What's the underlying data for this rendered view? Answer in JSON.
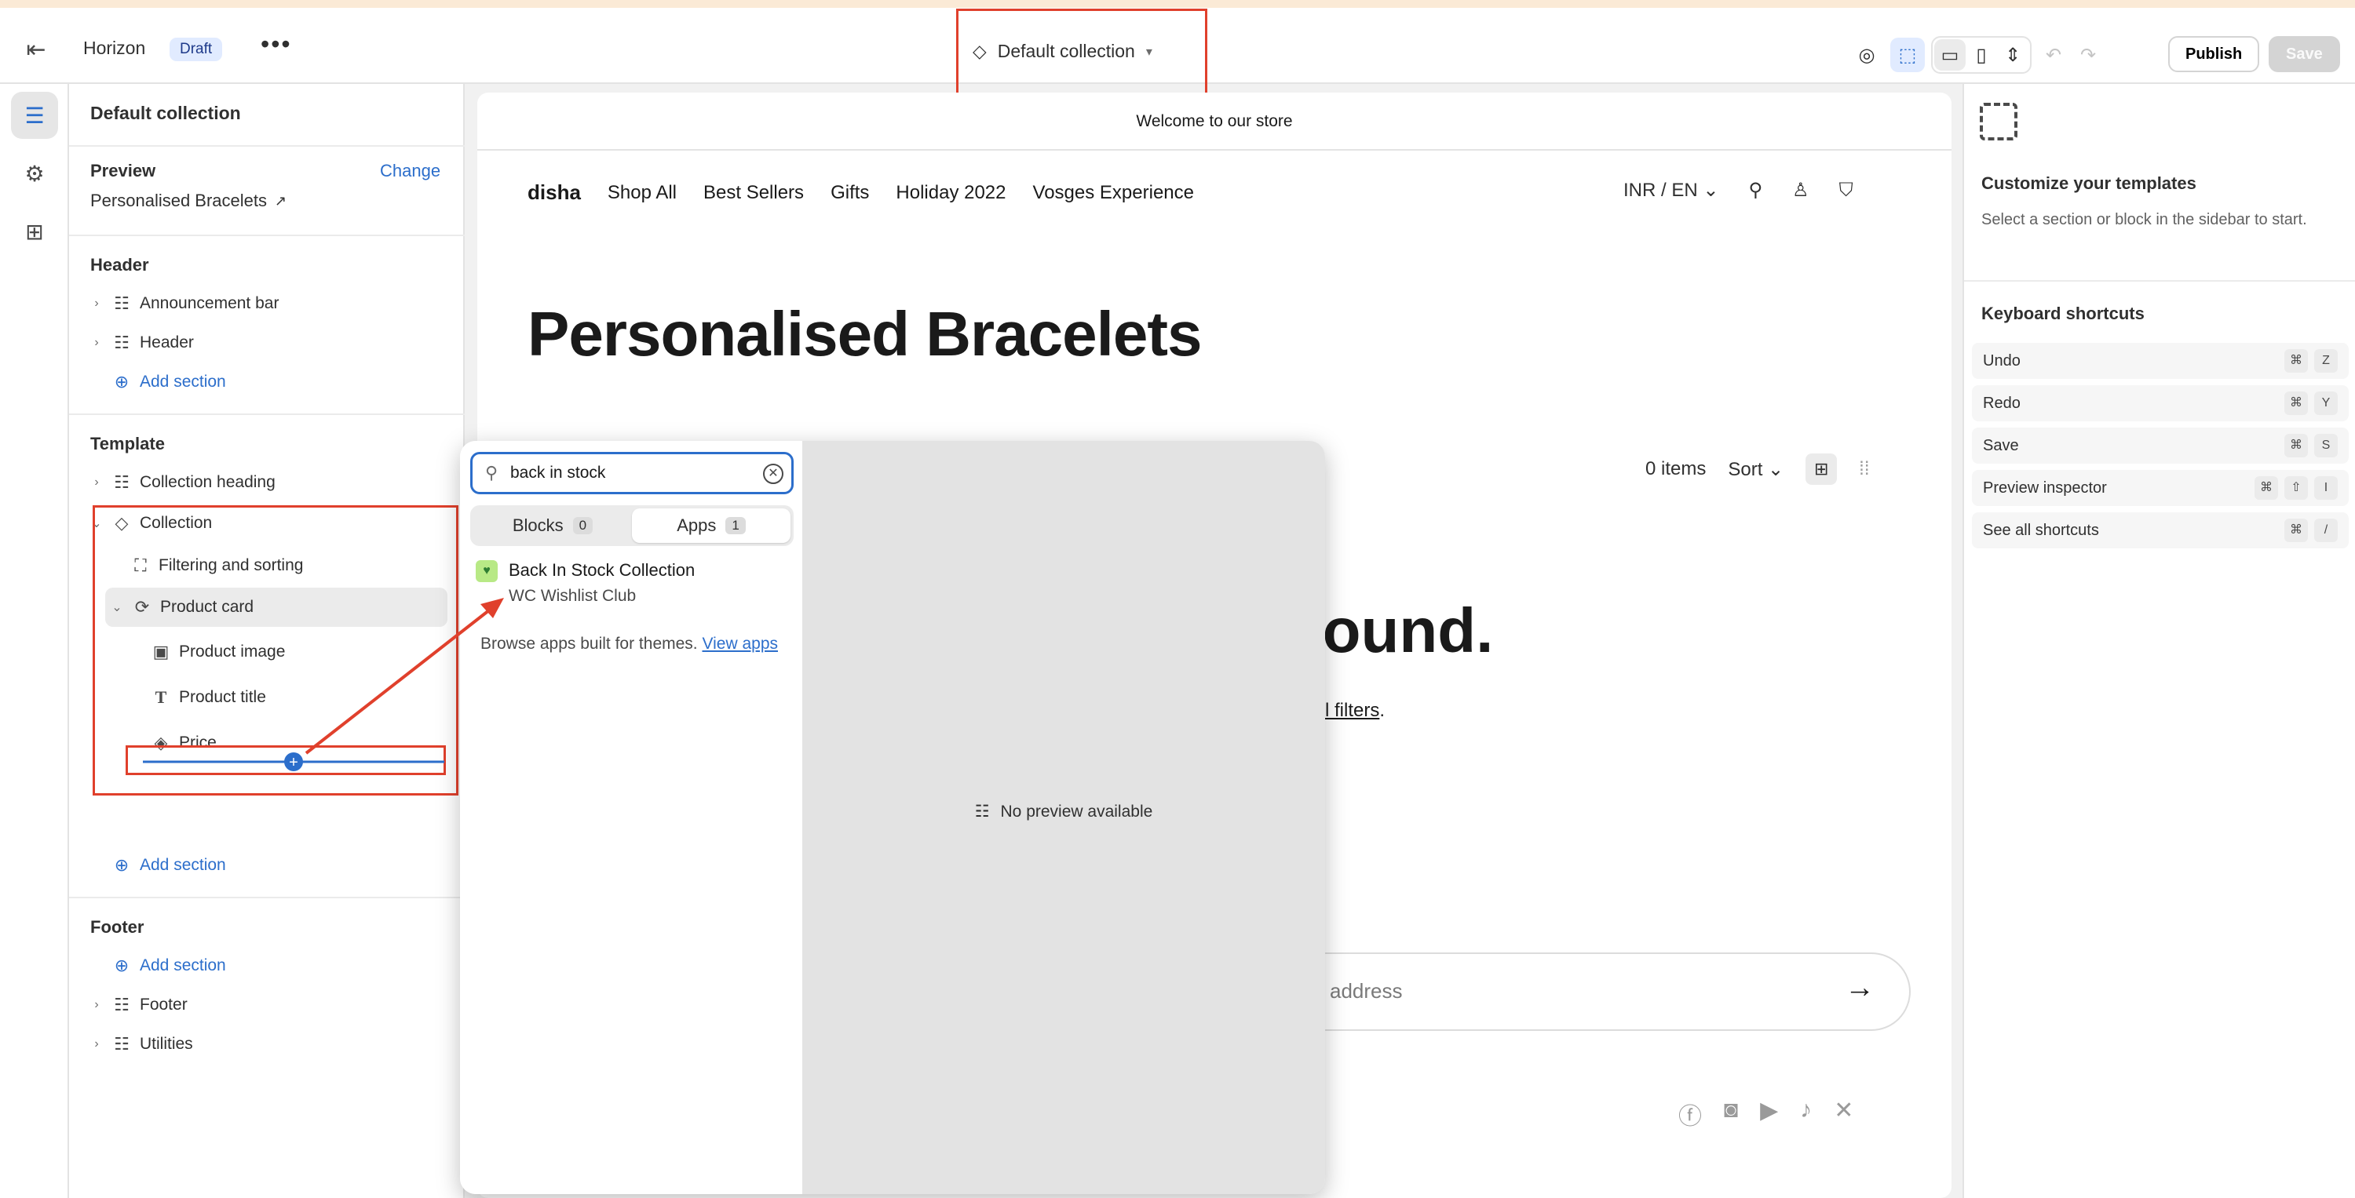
{
  "topbar": {
    "theme_name": "Horizon",
    "draft_badge": "Draft",
    "more": "•••",
    "template_selector": "Default collection",
    "publish_label": "Publish",
    "save_label": "Save"
  },
  "sidebar": {
    "title": "Default collection",
    "preview_label": "Preview",
    "change_link": "Change",
    "preview_item": "Personalised Bracelets",
    "header_group": "Header",
    "header_items": [
      "Announcement bar",
      "Header"
    ],
    "add_section": "Add section",
    "template_group": "Template",
    "template_items": {
      "collection_heading": "Collection heading",
      "collection": "Collection",
      "filtering": "Filtering and sorting",
      "product_card": "Product card",
      "product_image": "Product image",
      "product_title": "Product title",
      "price": "Price"
    },
    "footer_group": "Footer",
    "footer_items": [
      "Footer",
      "Utilities"
    ]
  },
  "store": {
    "announcement": "Welcome to our store",
    "logo": "disha",
    "nav": [
      "Shop All",
      "Best Sellers",
      "Gifts",
      "Holiday 2022",
      "Vosges Experience"
    ],
    "currency": "INR / EN",
    "heading": "Personalised Bracelets",
    "item_count": "0 items",
    "sort_label": "Sort",
    "not_found": "found.",
    "filters_text": "l filters",
    "email_placeholder": "address"
  },
  "popup": {
    "search_value": "back in stock",
    "tabs": [
      {
        "label": "Blocks",
        "count": "0"
      },
      {
        "label": "Apps",
        "count": "1"
      }
    ],
    "app_name": "Back In Stock Collection",
    "app_vendor": "WC Wishlist Club",
    "browse_text": "Browse apps built for themes.",
    "browse_link": "View apps",
    "no_preview": "No preview available"
  },
  "right_panel": {
    "title": "Customize your templates",
    "description": "Select a section or block in the sidebar to start.",
    "shortcuts_title": "Keyboard shortcuts",
    "shortcuts": [
      {
        "label": "Undo",
        "keys": [
          "⌘",
          "Z"
        ]
      },
      {
        "label": "Redo",
        "keys": [
          "⌘",
          "Y"
        ]
      },
      {
        "label": "Save",
        "keys": [
          "⌘",
          "S"
        ]
      },
      {
        "label": "Preview inspector",
        "keys": [
          "⌘",
          "⇧",
          "I"
        ]
      },
      {
        "label": "See all shortcuts",
        "keys": [
          "⌘",
          "/"
        ]
      }
    ]
  },
  "colors": {
    "accent": "#2c6ecb",
    "annotation_red": "#e0402c"
  }
}
